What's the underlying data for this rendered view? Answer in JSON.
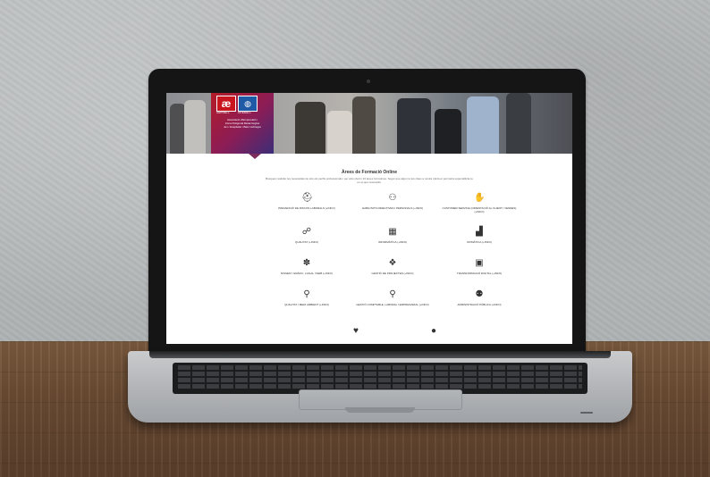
{
  "header": {
    "logo_a": "æ",
    "logo_a_label": "AEPDELL",
    "logo_b_label": "OPEDELL",
    "org_line_1": "Associació d'Empresaris i",
    "org_line_2": "Zona Polígonal Metal·lúrgica",
    "org_line_3": "de L'Hospitalet i Baix Llobregat"
  },
  "main": {
    "title": "Àrees de Formació Online",
    "subtitle": "Busquem satisfer les necessitats de tots els perfils professionals i per això oferim 16 àrees formatives. Segur que algun té les claus a nostra oferta et permetrà especialitzar-te en el que necessitis.",
    "areas": [
      {
        "label": "PREVENCIÓ DE RISCOS LABORALS (+INFO)",
        "icon": "hard-hat-icon"
      },
      {
        "label": "HABILITATS DIRECTIVES I PERSONALS (+INFO)",
        "icon": "people-icon"
      },
      {
        "label": "CUSTOMER SERVICE (ORIENTACIÓ AL CLIENT I VENDES) (+INFO)",
        "icon": "hand-service-icon"
      },
      {
        "label": "QUALITAT (+INFO)",
        "icon": "handshake-icon"
      },
      {
        "label": "INFORMÀTICA (+INFO)",
        "icon": "calculator-icon"
      },
      {
        "label": "OFIMÀTICA (+INFO)",
        "icon": "bar-chart-icon"
      },
      {
        "label": "DISSENY GRÀFIC, LOGAL I WEB (+INFO)",
        "icon": "palette-icon"
      },
      {
        "label": "GESTIÓ DE PROJECTES (+INFO)",
        "icon": "cubes-icon"
      },
      {
        "label": "TRANSFORMACIÓ DIGITAL (+INFO)",
        "icon": "screen-icon"
      },
      {
        "label": "QUALITAT I MEDI AMBIENT (+INFO)",
        "icon": "location-pin-icon"
      },
      {
        "label": "GESTIÓ COMPTABLE, LABORAL I EMPRESARIAL (+INFO)",
        "icon": "magnifier-icon"
      },
      {
        "label": "ADMINISTRACIÓ PÚBLICA (+INFO)",
        "icon": "users-admin-icon"
      },
      {
        "label": "",
        "icon": "heart-icon"
      },
      {
        "label": "",
        "icon": "chat-bubble-icon"
      }
    ]
  }
}
